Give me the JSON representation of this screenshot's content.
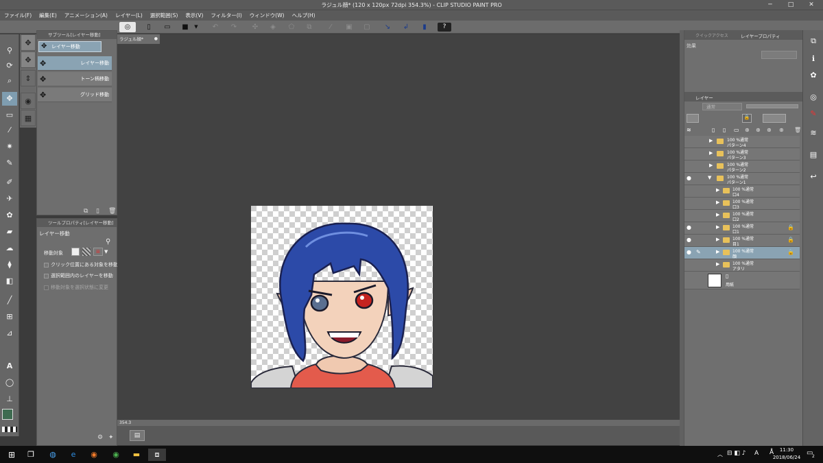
{
  "window": {
    "title": "ラジュル顔* (120 x 120px 72dpi 354.3%) - CLIP STUDIO PAINT PRO",
    "minimize": "─",
    "maximize": "□",
    "close": "✕"
  },
  "menu": [
    "ファイル(F)",
    "編集(E)",
    "アニメーション(A)",
    "レイヤー(L)",
    "選択範囲(S)",
    "表示(V)",
    "フィルター(I)",
    "ウィンドウ(W)",
    "ヘルプ(H)"
  ],
  "command_bar": {
    "icons": [
      "clip-studio-icon",
      "new-icon",
      "open-icon",
      "save-icon",
      "dropdown-icon",
      "undo-icon",
      "redo-icon",
      "clear-icon",
      "fill-icon",
      "transform-icon",
      "crop-icon",
      "pen-icon",
      "select-icon",
      "snap-icon",
      "ruler-icon",
      "special-ruler-icon",
      "info-icon",
      "help-icon"
    ]
  },
  "tools": {
    "icons": [
      "zoom-icon",
      "rotate-icon",
      "magnifier-icon",
      "move-layer-icon",
      "select-rect-icon",
      "eyedropper-icon",
      "auto-select-icon",
      "pen-icon",
      "brush-icon",
      "airbrush-icon",
      "decoration-icon",
      "eraser-icon",
      "blend-icon",
      "fill-icon",
      "gradient-icon",
      "figure-icon",
      "frame-icon",
      "text-icon",
      "balloon-icon",
      "correct-line-icon",
      "color-swatch-icon"
    ]
  },
  "subtool": {
    "tab": "サブツール[レイヤー移動]",
    "group": "レイヤー移動",
    "items": [
      {
        "label": "レイヤー移動",
        "selected": true
      },
      {
        "label": "トーン柄移動",
        "selected": false
      },
      {
        "label": "グリッド移動",
        "selected": false
      }
    ]
  },
  "tool_property": {
    "tab": "ツールプロパティ[レイヤー移動]",
    "title": "レイヤー移動",
    "target_label": "移動対象",
    "options": [
      {
        "label": "クリック位置にある対象を移動",
        "checked": false,
        "disabled": false
      },
      {
        "label": "選択範囲内のレイヤーを移動",
        "checked": false,
        "disabled": false
      },
      {
        "label": "移動対象を選択状態に変更",
        "checked": false,
        "disabled": true
      }
    ]
  },
  "canvas": {
    "doc_tab": "ラジュル顔*",
    "status": "354.3"
  },
  "layer_panel": {
    "tabs": [
      "クイックアクセス",
      "レイヤープロパティ"
    ],
    "effect_label": "効果",
    "layer_tab": "レイヤー",
    "blend_mode": "通常",
    "layers": [
      {
        "opacity": "100 %通常",
        "name": "パターン4",
        "visible": false,
        "expanded": false,
        "indent": 0,
        "locked": false,
        "selected": false
      },
      {
        "opacity": "100 %通常",
        "name": "パターン3",
        "visible": false,
        "expanded": false,
        "indent": 0,
        "locked": false,
        "selected": false
      },
      {
        "opacity": "100 %通常",
        "name": "パターン2",
        "visible": false,
        "expanded": false,
        "indent": 0,
        "locked": false,
        "selected": false
      },
      {
        "opacity": "100 %通常",
        "name": "パターン1",
        "visible": true,
        "expanded": true,
        "indent": 0,
        "locked": false,
        "selected": false
      },
      {
        "opacity": "100 %通常",
        "name": "口4",
        "visible": false,
        "expanded": false,
        "indent": 1,
        "locked": false,
        "selected": false
      },
      {
        "opacity": "100 %通常",
        "name": "口3",
        "visible": false,
        "expanded": false,
        "indent": 1,
        "locked": false,
        "selected": false
      },
      {
        "opacity": "100 %通常",
        "name": "口2",
        "visible": false,
        "expanded": false,
        "indent": 1,
        "locked": false,
        "selected": false
      },
      {
        "opacity": "100 %通常",
        "name": "口1",
        "visible": true,
        "expanded": false,
        "indent": 1,
        "locked": true,
        "selected": false
      },
      {
        "opacity": "100 %通常",
        "name": "目1",
        "visible": true,
        "expanded": false,
        "indent": 1,
        "locked": true,
        "selected": false
      },
      {
        "opacity": "100 %通常",
        "name": "顔",
        "visible": true,
        "expanded": false,
        "indent": 1,
        "locked": true,
        "selected": true
      },
      {
        "opacity": "100 %通常",
        "name": "アタリ",
        "visible": false,
        "expanded": false,
        "indent": 1,
        "locked": false,
        "selected": false
      }
    ],
    "paper_label": "用紙"
  },
  "taskbar": {
    "time": "11:30",
    "date": "2018/06/24",
    "notification_count": "2"
  },
  "colors": {
    "accent": "#8aa3b3",
    "folder": "#e8c15a",
    "hair": "#2b4aa8",
    "scarf": "#e05545"
  }
}
